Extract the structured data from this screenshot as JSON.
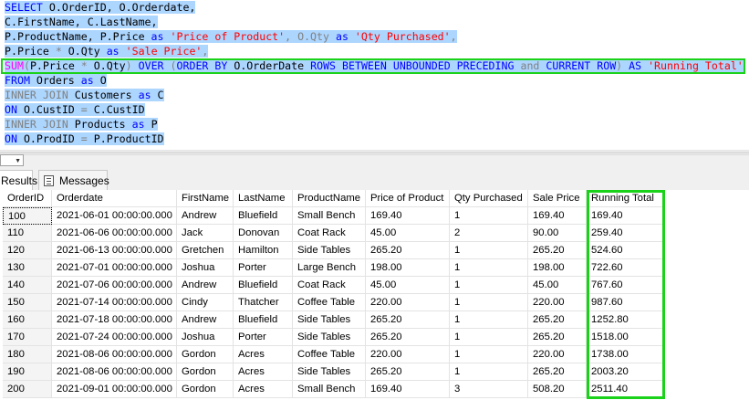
{
  "editor": {
    "sql_line1": {
      "kw1": "SELECT",
      "rest": " O.OrderID, O.Orderdate,"
    },
    "sql_line2": {
      "text": "C.FirstName, C.LastName,"
    },
    "sql_line3": {
      "a": "P.ProductName, P.Price ",
      "as1": "as",
      "s1": " 'Price of Product'",
      "b": ", O.Qty ",
      "as2": "as",
      "s2": " 'Qty Purchased'",
      "c": ","
    },
    "sql_line4": {
      "a": "P.Price ",
      "op": "*",
      "b": " O.Qty ",
      "as1": "as",
      "s1": " 'Sale Price'",
      "c": ","
    },
    "sql_line5": {
      "fn": "SUM",
      "p1": "(",
      "a": "P.Price ",
      "op": "*",
      "b": " O.Qty",
      "p2": ")",
      "over": " OVER ",
      "p3": "(",
      "orderby": "ORDER BY",
      "c": " O.OrderDate ",
      "rows": "ROWS BETWEEN UNBOUNDED PRECEDING",
      "and": " and ",
      "cur": "CURRENT ROW",
      "p4": ")",
      "as1": " AS ",
      "s1": "'Running Total'"
    },
    "sql_line6": {
      "kw": "FROM",
      "rest": " Orders ",
      "as1": "as",
      "alias": " O"
    },
    "sql_line7": {
      "kw": "INNER JOIN",
      "rest": " Customers ",
      "as1": "as",
      "alias": " C"
    },
    "sql_line8": {
      "kw": "ON",
      "rest": " O.CustID ",
      "eq": "=",
      "rest2": " C.CustID"
    },
    "sql_line9": {
      "kw": "INNER JOIN",
      "rest": " Products ",
      "as1": "as",
      "alias": " P"
    },
    "sql_line10": {
      "kw": "ON",
      "rest": " O.ProdID ",
      "eq": "=",
      "rest2": " P.ProductID"
    }
  },
  "tabs": {
    "results": "Results",
    "messages": "Messages"
  },
  "grid": {
    "columns": [
      "OrderID",
      "Orderdate",
      "FirstName",
      "LastName",
      "ProductName",
      "Price of Product",
      "Qty Purchased",
      "Sale Price",
      "Running Total"
    ],
    "rows": [
      [
        "100",
        "2021-06-01 00:00:00.000",
        "Andrew",
        "Bluefield",
        "Small Bench",
        "169.40",
        "1",
        "169.40",
        "169.40"
      ],
      [
        "110",
        "2021-06-06 00:00:00.000",
        "Jack",
        "Donovan",
        "Coat Rack",
        "45.00",
        "2",
        "90.00",
        "259.40"
      ],
      [
        "120",
        "2021-06-13 00:00:00.000",
        "Gretchen",
        "Hamilton",
        "Side Tables",
        "265.20",
        "1",
        "265.20",
        "524.60"
      ],
      [
        "130",
        "2021-07-01 00:00:00.000",
        "Joshua",
        "Porter",
        "Large Bench",
        "198.00",
        "1",
        "198.00",
        "722.60"
      ],
      [
        "140",
        "2021-07-06 00:00:00.000",
        "Andrew",
        "Bluefield",
        "Coat Rack",
        "45.00",
        "1",
        "45.00",
        "767.60"
      ],
      [
        "150",
        "2021-07-14 00:00:00.000",
        "Cindy",
        "Thatcher",
        "Coffee Table",
        "220.00",
        "1",
        "220.00",
        "987.60"
      ],
      [
        "160",
        "2021-07-18 00:00:00.000",
        "Andrew",
        "Bluefield",
        "Side Tables",
        "265.20",
        "1",
        "265.20",
        "1252.80"
      ],
      [
        "170",
        "2021-07-24 00:00:00.000",
        "Joshua",
        "Porter",
        "Side Tables",
        "265.20",
        "1",
        "265.20",
        "1518.00"
      ],
      [
        "180",
        "2021-08-06 00:00:00.000",
        "Gordon",
        "Acres",
        "Coffee Table",
        "220.00",
        "1",
        "220.00",
        "1738.00"
      ],
      [
        "190",
        "2021-08-06 00:00:00.000",
        "Gordon",
        "Acres",
        "Side Tables",
        "265.20",
        "1",
        "265.20",
        "2003.20"
      ],
      [
        "200",
        "2021-09-01 00:00:00.000",
        "Gordon",
        "Acres",
        "Small Bench",
        "169.40",
        "3",
        "508.20",
        "2511.40"
      ]
    ]
  },
  "colors": {
    "selection": "#add6ff",
    "keyword": "#0000ff",
    "string": "#ff0000",
    "function": "#ff00ff",
    "highlight_box": "#19d219"
  }
}
